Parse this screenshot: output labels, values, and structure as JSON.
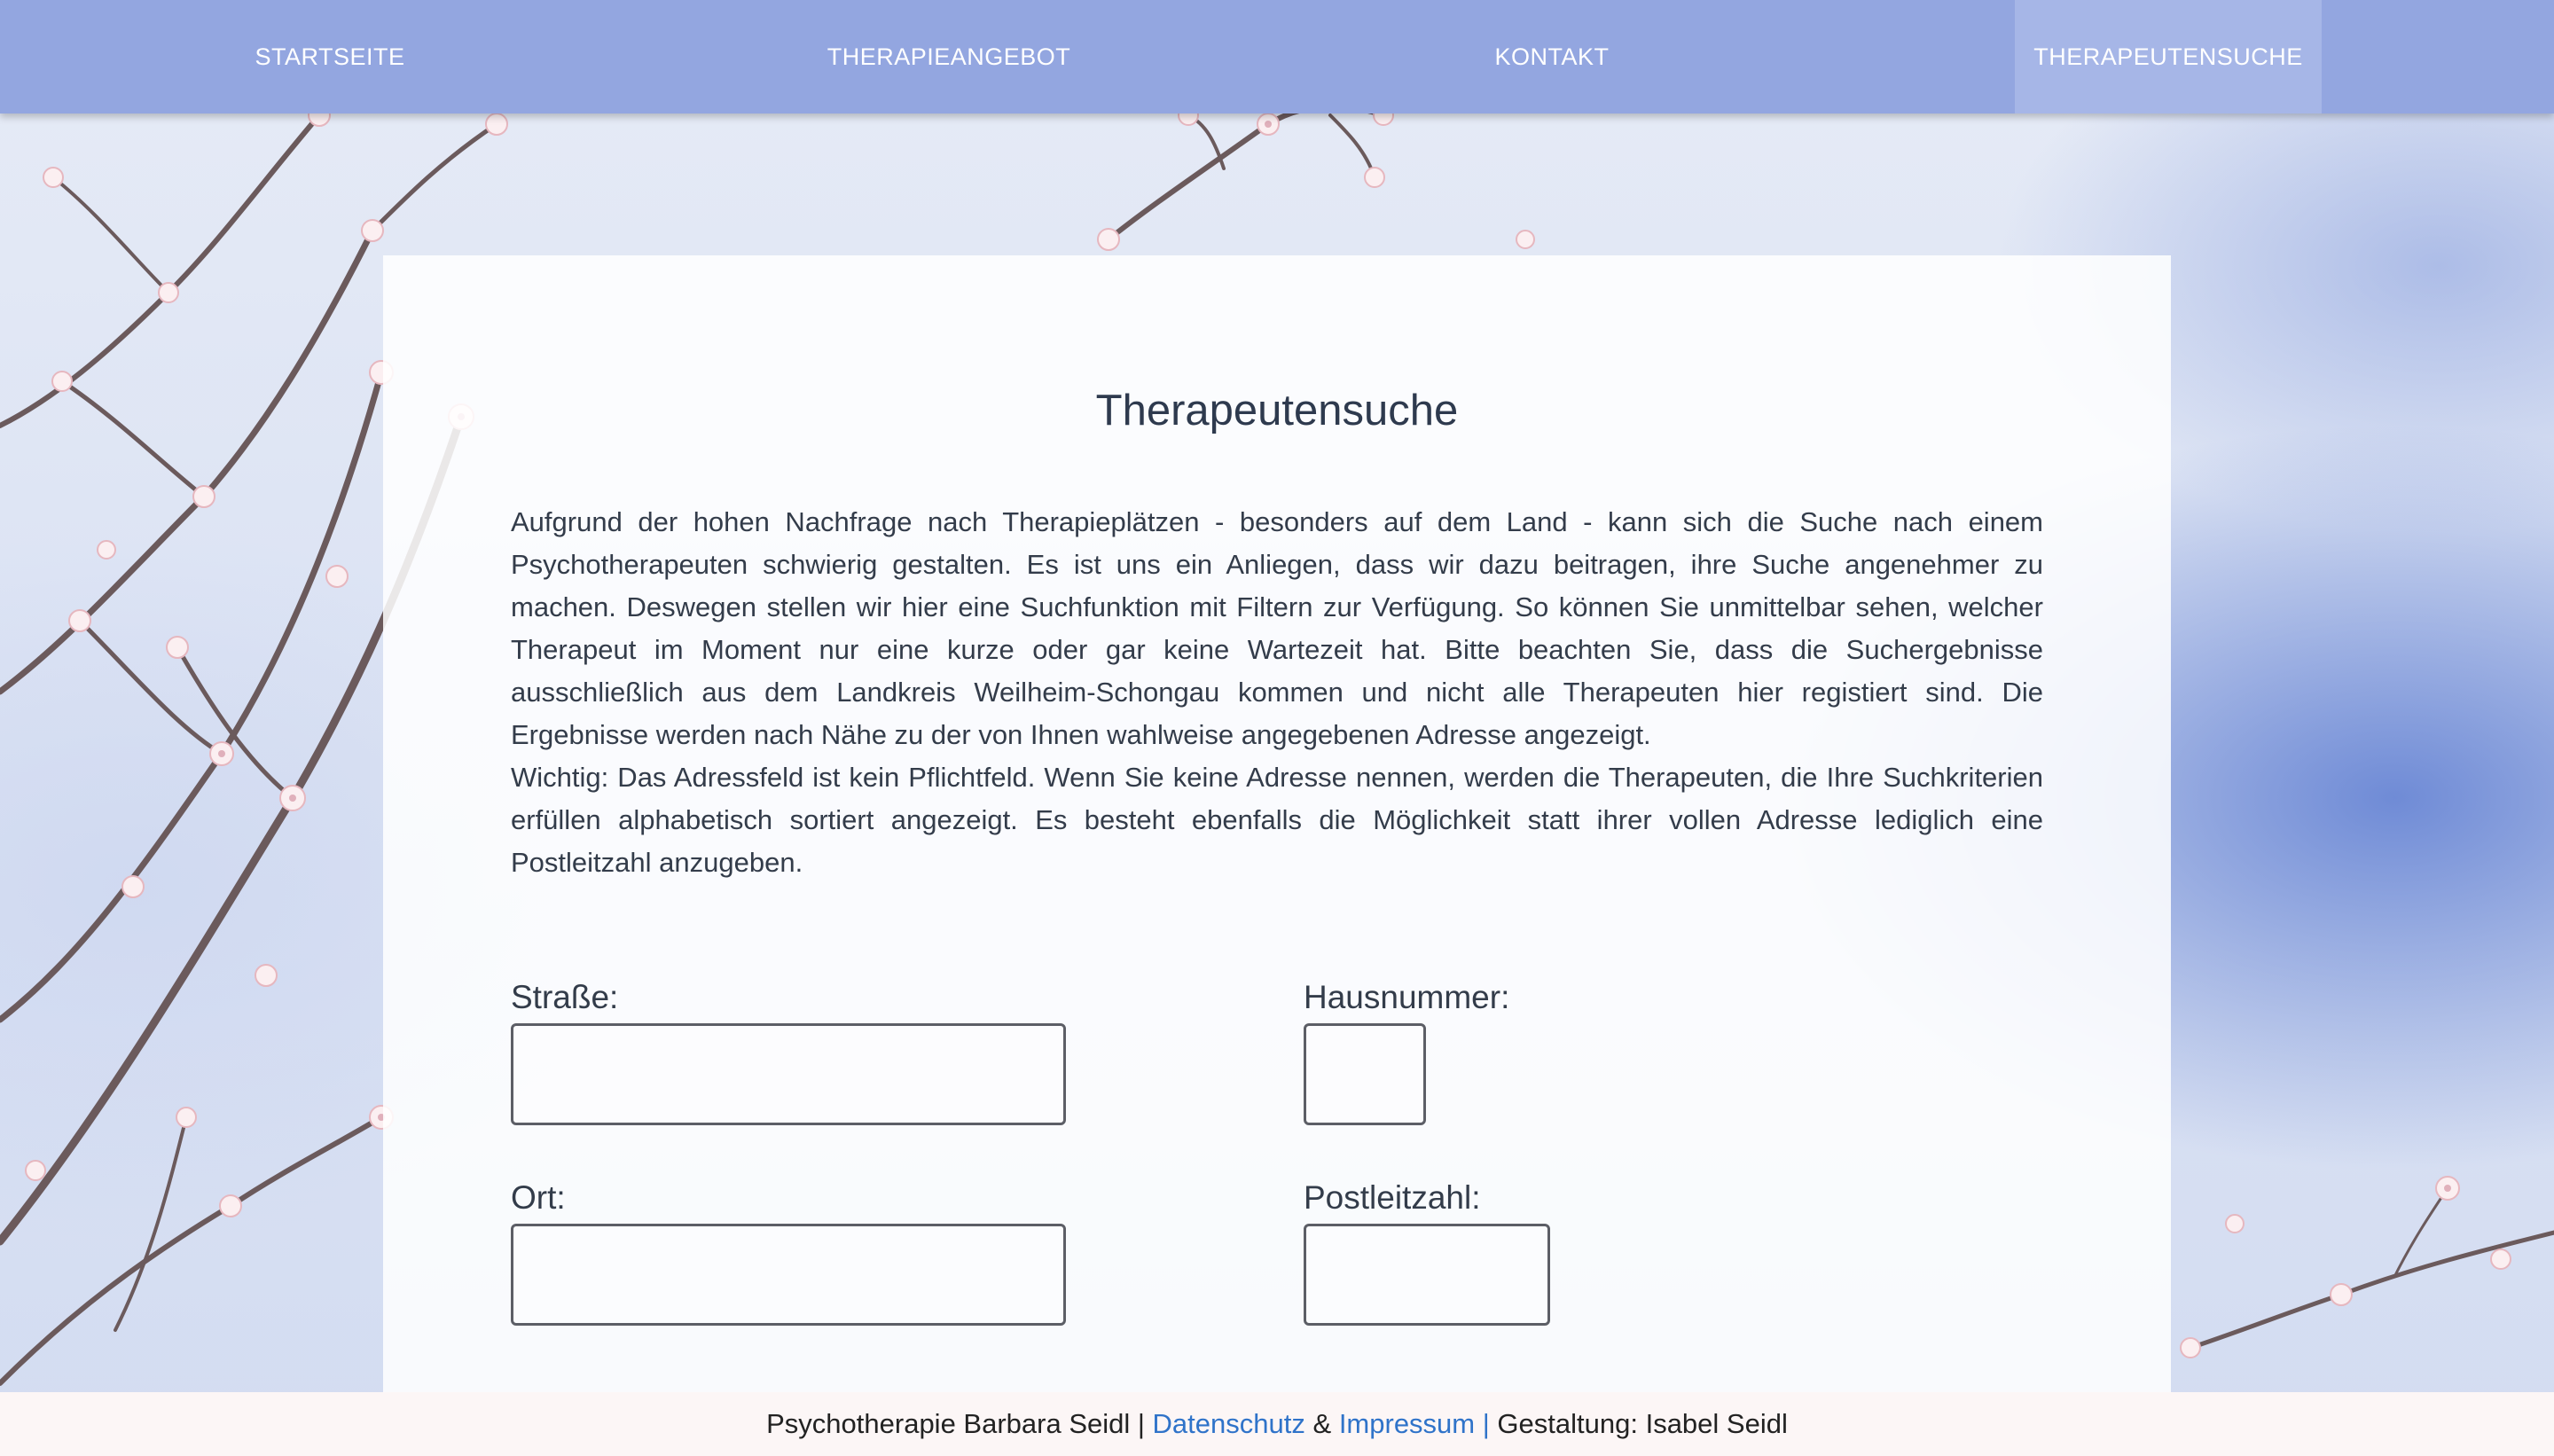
{
  "nav": {
    "items": [
      {
        "label": "STARTSEITE"
      },
      {
        "label": "THERAPIEANGEBOT"
      },
      {
        "label": "KONTAKT"
      },
      {
        "label": "THERAPEUTENSUCHE"
      }
    ],
    "active_index": 3
  },
  "main": {
    "title": "Therapeutensuche",
    "paragraph_1": "Aufgrund der hohen Nachfrage nach Therapieplätzen - besonders auf dem Land - kann sich die Suche nach einem Psychotherapeuten schwierig gestalten. Es ist uns ein Anliegen, dass wir dazu beitragen, ihre Suche angenehmer zu machen. Deswegen stellen wir hier eine Suchfunktion mit Filtern zur Verfügung. So können Sie unmittelbar sehen, welcher Therapeut im Moment nur eine kurze oder gar keine Wartezeit hat. Bitte beachten Sie, dass die Suchergebnisse ausschließlich aus dem Landkreis Weilheim-Schongau kommen und nicht alle Therapeuten hier registiert sind. Die Ergebnisse werden nach Nähe zu der von Ihnen wahlweise angegebenen Adresse angezeigt.",
    "paragraph_2": "Wichtig: Das Adressfeld ist kein Pflichtfeld. Wenn Sie keine Adresse nennen, werden die Therapeuten, die Ihre Suchkriterien erfüllen alphabetisch sortiert angezeigt. Es besteht ebenfalls die Möglichkeit statt ihrer vollen Adresse lediglich eine Postleitzahl anzugeben."
  },
  "form": {
    "street_label": "Straße:",
    "street_value": "",
    "house_number_label": "Hausnummer:",
    "house_number_value": "",
    "city_label": "Ort:",
    "city_value": "",
    "postal_code_label": "Postleitzahl:",
    "postal_code_value": ""
  },
  "footer": {
    "owner": "Psychotherapie Barbara Seidl |",
    "privacy_link": "Datenschutz",
    "ampersand": "&",
    "imprint_link": "Impressum |",
    "design_credit": "Gestaltung: Isabel Seidl"
  },
  "colors": {
    "nav_background": "#93a6e0",
    "nav_active": "#a6b6e7",
    "link": "#2f73c9",
    "footer_background": "#fcf6f6"
  }
}
